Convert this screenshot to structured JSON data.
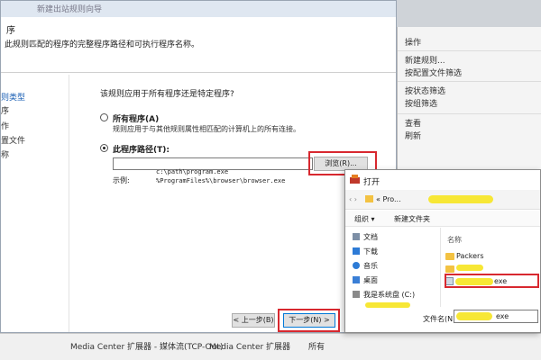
{
  "wizard": {
    "title": "新建出站规则向导",
    "step_title": "序",
    "step_desc": "此规则匹配的程序的完整程序路径和可执行程序名称。",
    "steps": [
      "则类型",
      "序",
      "作",
      "置文件",
      "称"
    ],
    "question": "该规则应用于所有程序还是特定程序?",
    "option_all_label": "所有程序(A)",
    "option_all_desc": "规则应用于与其他规则属性相匹配的计算机上的所有连接。",
    "option_path_label": "此程序路径(T):",
    "path_value": "",
    "browse_label": "浏览(R)...",
    "example_label": "示例:",
    "example_lines": [
      "c:\\path\\program.exe",
      "%ProgramFiles%\\browser\\browser.exe"
    ],
    "back_label": "< 上一步(B)",
    "next_label": "下一步(N) >"
  },
  "background": {
    "items": [
      "操作",
      "新建规则...",
      "按配置文件筛选",
      "按状态筛选",
      "按组筛选",
      "查看",
      "刷新"
    ]
  },
  "bottom_strip": {
    "cells": [
      "Media Center 扩展器 - 媒体流(TCP-Out)",
      "Media Center 扩展器",
      "所有"
    ]
  },
  "open_dialog": {
    "title": "打开",
    "address": "« Pro...",
    "organize_label": "组织 ▾",
    "new_folder_label": "新建文件夹",
    "nav_items": [
      "文档",
      "下载",
      "音乐",
      "桌面",
      "我是系统盘 (C:)"
    ],
    "files_header": "名称",
    "files": [
      "Packers",
      "exe"
    ],
    "filename_label": "文件名(N):",
    "filename_value": "exe"
  },
  "colors": {
    "highlight": "#d8282f",
    "redaction": "#f7e62a",
    "folder": "#f3c242",
    "accent": "#1a5fb4"
  }
}
